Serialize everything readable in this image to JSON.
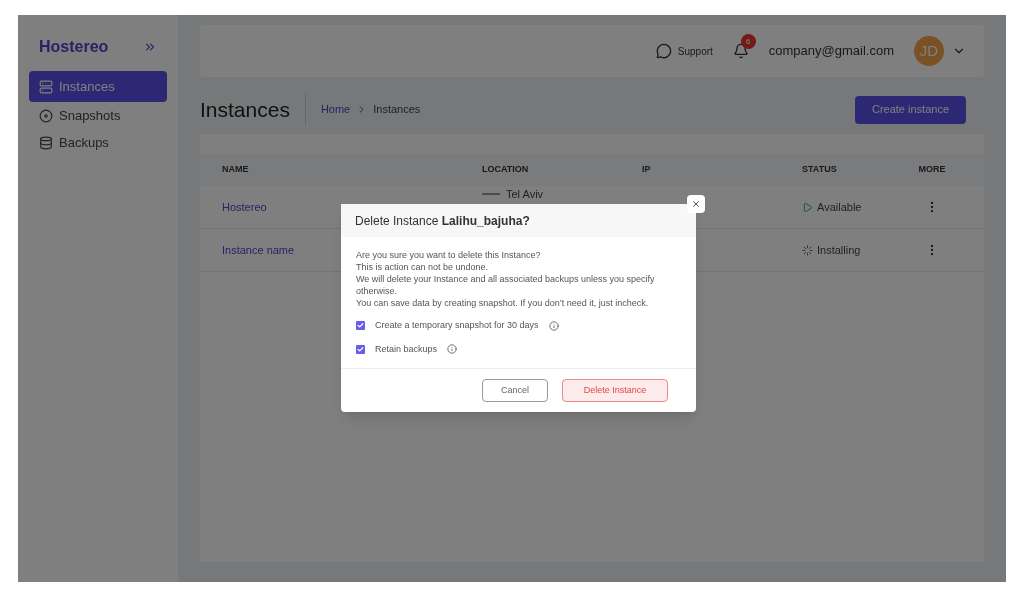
{
  "sidebar": {
    "brand": "Hostereo",
    "items": [
      {
        "label": "Instances",
        "kind": "server",
        "selected": true
      },
      {
        "label": "Snapshots",
        "kind": "disc",
        "selected": false
      },
      {
        "label": "Backups",
        "kind": "database",
        "selected": false
      }
    ]
  },
  "header": {
    "support": "Support",
    "notifications": "6",
    "email": "company@gmail.com",
    "avatar": "JD"
  },
  "page": {
    "title": "Instances",
    "breadcrumb": [
      "Home",
      "Instances"
    ],
    "create_button": "Create instance"
  },
  "table": {
    "columns": [
      "NAME",
      "LOCATION",
      "IP",
      "STATUS",
      "MORE"
    ],
    "rows": [
      {
        "name": "Hostereo",
        "location": "Tel Aviv",
        "status": "Available",
        "kind": "available"
      },
      {
        "name": "Instance name",
        "status": "Installing",
        "kind": "installing"
      }
    ]
  },
  "dialog": {
    "title": "Delete Instance **Lalihu_bajuha?**",
    "message": [
      "Are you sure you want to delete this Instance?",
      "This is action can not be undone.",
      "We will delete your Instance and all associated backups unless you specify otherwise.",
      "You can save data by creating snapshot. If you don’t need it, just incheck."
    ],
    "options": [
      {
        "label": "Create a temporary snapshot for 30 days",
        "checked": true
      },
      {
        "label": "Retain backups",
        "checked": true
      }
    ],
    "cancel": "Cancel",
    "confirm": "Delete Instance"
  }
}
